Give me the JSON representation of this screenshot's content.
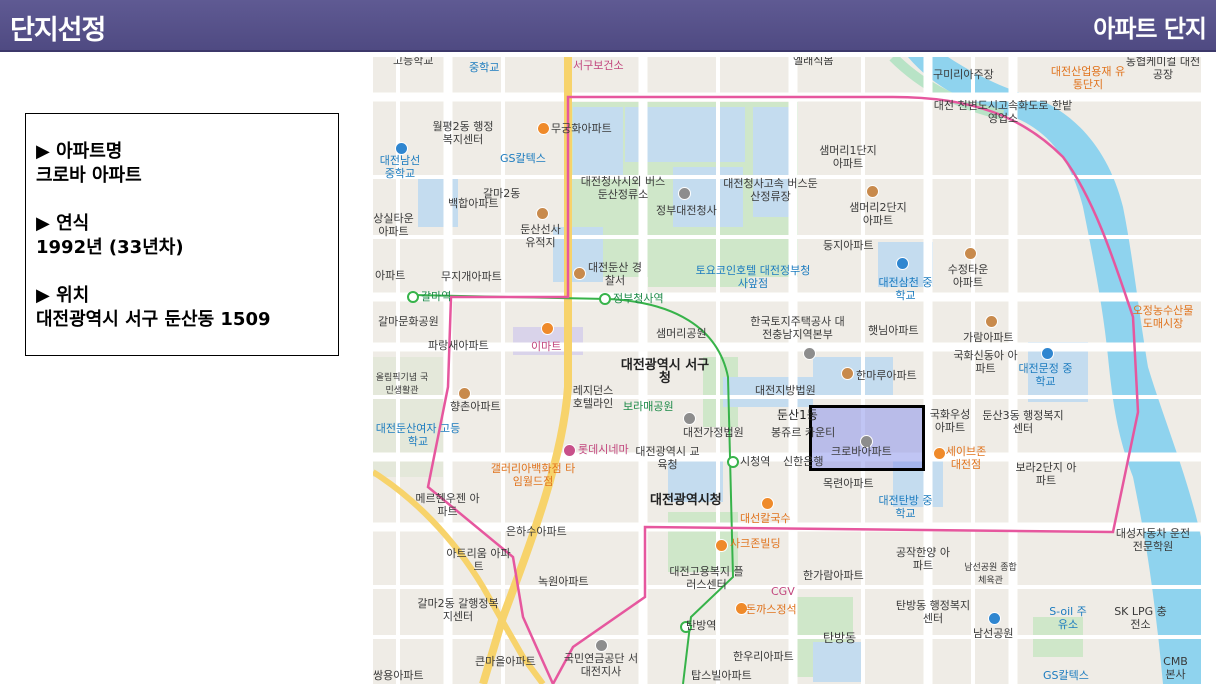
{
  "header": {
    "title": "단지선정",
    "subtitle": "아파트 단지"
  },
  "info": {
    "name_label": "▶ 아파트명",
    "name_value": "크로바 아파트",
    "year_label": "▶ 연식",
    "year_value": "1992년 (33년차)",
    "location_label": "▶ 위치",
    "location_value": "대전광역시 서구 둔산동 1509"
  },
  "colors": {
    "header": "#5a5590",
    "boundary": "#e6579e",
    "river": "#8fd3ee",
    "highlight": "#8c96eb"
  },
  "map": {
    "labels": [
      "고등학교",
      "중학교",
      "서구보건소",
      "엘래식봄",
      "구미리아주장",
      "대전산업용재 유통단지",
      "농협케미컬 대전공장",
      "월평2동 행정복지센터",
      "무궁화아파트",
      "GS칼텍스",
      "대전남선 중학교",
      "대전청사시외 버스둔산정류소",
      "대전청사고속 버스둔산정류장",
      "정부대전청사",
      "샘머리1단지 아파트",
      "대전 천변도시고속화도로 한밭영업소",
      "갈마2동",
      "백합아파트",
      "샘머리2단지 아파트",
      "상실타운 아파트",
      "둔산선사 유적지",
      "둥지아파트",
      "대전둔산 경찰서",
      "토요코인호텔 대전정부청사앞점",
      "대전삼천 중학교",
      "수정타운 아파트",
      "오정농수산물 도매시장",
      "아파트",
      "무지개아파트",
      "갈마역",
      "정부청사역",
      "한국토지주택공사 대전충남지역본부",
      "햇님아파트",
      "가람아파트",
      "갈마문화공원",
      "이마트",
      "샘머리공원",
      "파랑새아파트",
      "대전광역시 서구청",
      "국화신동아 아파트",
      "대전문정 중학교",
      "한마루아파트",
      "레지던스 호텔라인",
      "대전지방법원",
      "올림픽기념 국민생활관",
      "보라매공원",
      "향촌아파트",
      "둔산1동",
      "국화우성 아파트",
      "둔산3동 행정복지센터",
      "봉쥬르 카운티",
      "크로바아파트",
      "대전둔산여자 고등학교",
      "대전가정법원",
      "롯데시네마",
      "대전광역시 교육청",
      "시청역",
      "신한은행",
      "세이브존 대전점",
      "보라2단지 아파트",
      "갤러리아백화점 타임월드점",
      "대전광역시청",
      "목련아파트",
      "대전탄방 중학교",
      "메르헨우젠 아파트",
      "대선칼국수",
      "은하수아파트",
      "대성자동차 운전전문학원",
      "아트리움 아파트",
      "사크존빌딩",
      "공작한양 아파트",
      "대전고용복지 플러스센터",
      "한가람아파트",
      "CGV",
      "남선공원 종합체육관",
      "녹원아파트",
      "갈마2동 갈행정복지센터",
      "돈까스정석",
      "탄방동 행정복지센터",
      "S-oil 주유소",
      "SK LPG 충전소",
      "탄방역",
      "탄방동",
      "남선공원",
      "큰마을아파트",
      "국민연금공단 서대전지사",
      "한우리아파트",
      "CMB 본사",
      "쌍용아파트",
      "탑스빌아파트",
      "GS칼텍스"
    ]
  }
}
